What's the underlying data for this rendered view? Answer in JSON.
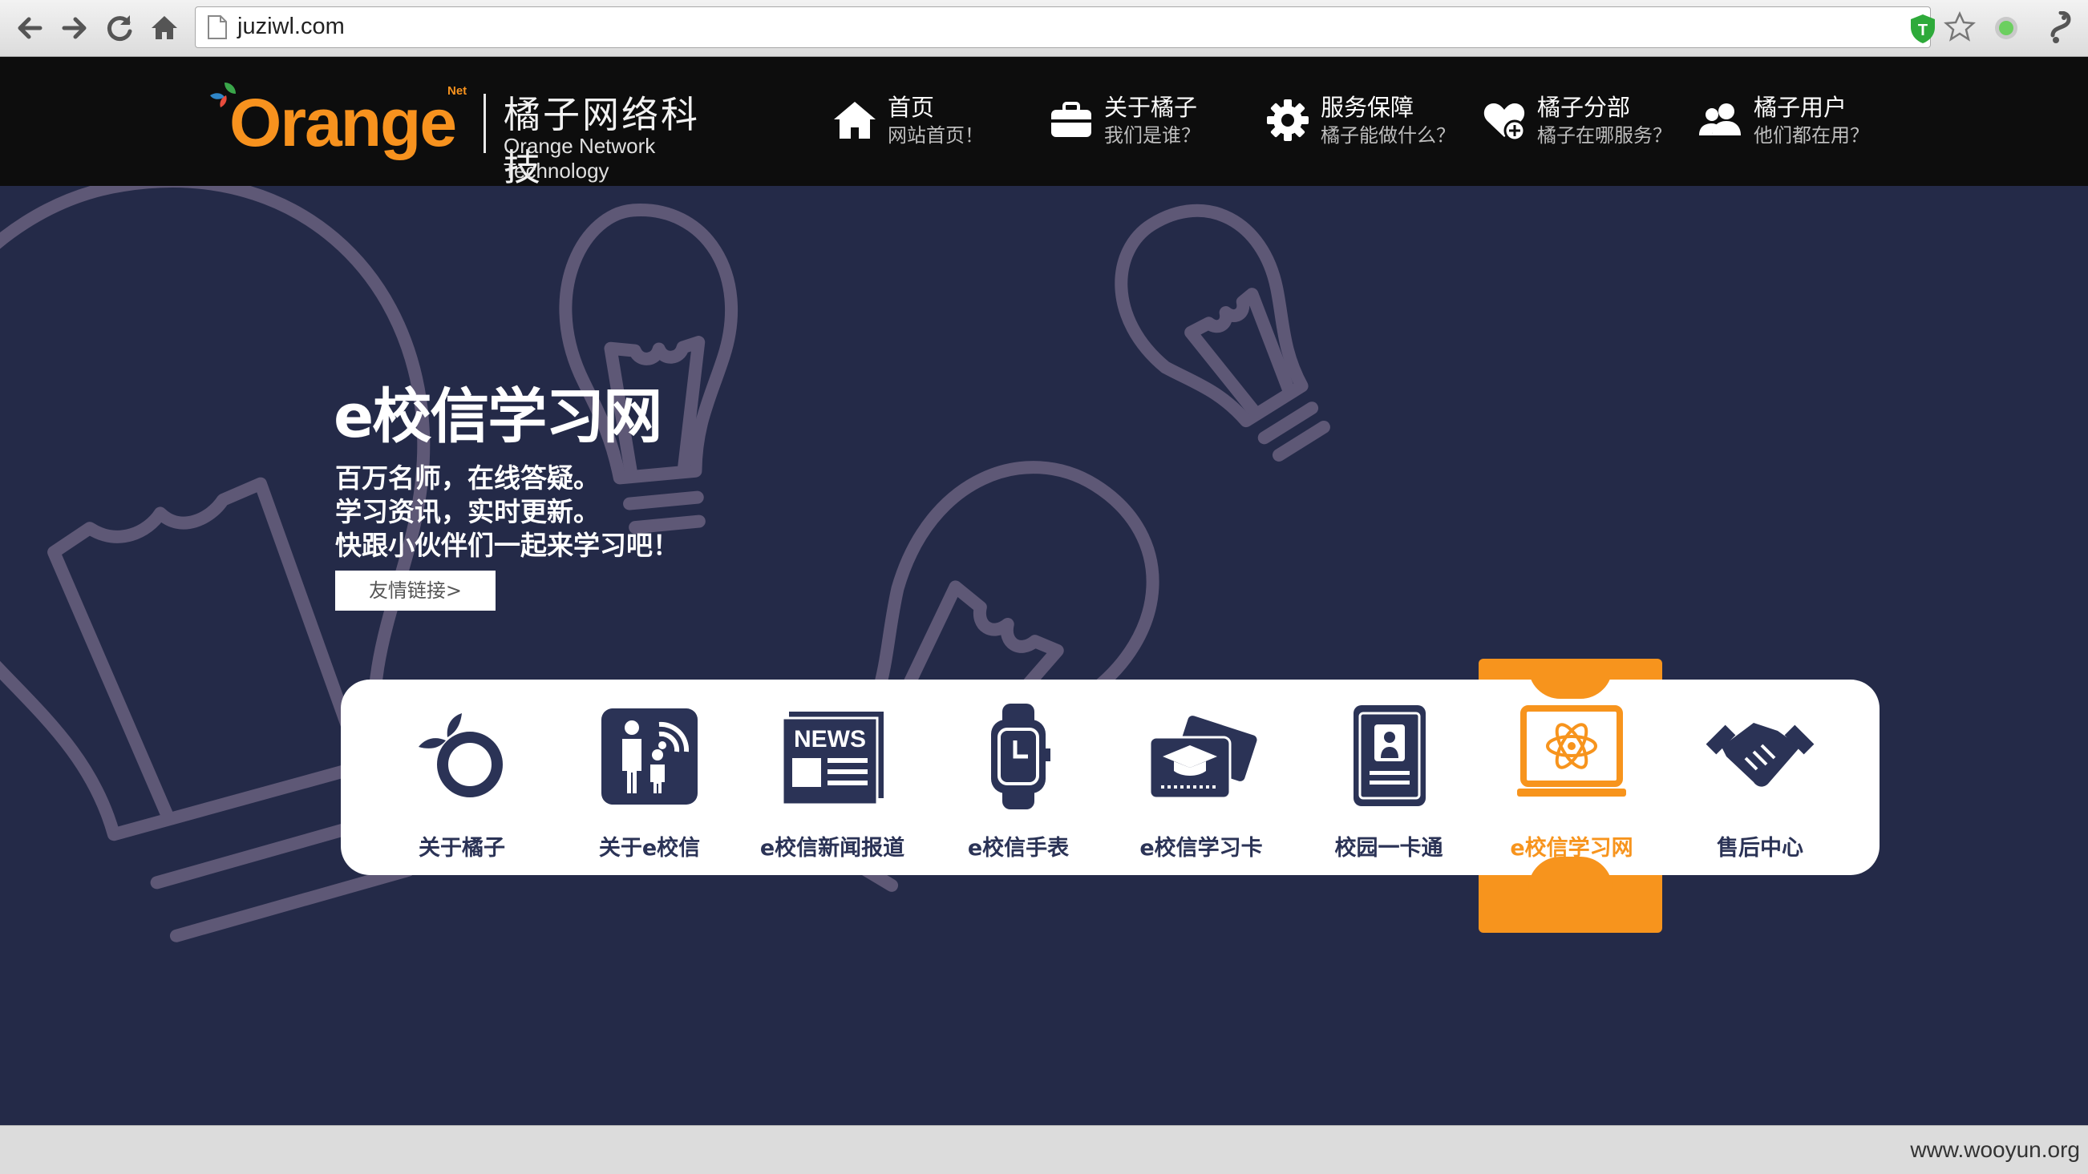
{
  "browser": {
    "url": "juziwl.com",
    "back_icon": "back-arrow-icon",
    "forward_icon": "forward-arrow-icon",
    "reload_icon": "reload-icon",
    "home_icon": "home-icon"
  },
  "header": {
    "logo_word": "Orange",
    "logo_net": "Net",
    "logo_cn": "橘子网络科技",
    "logo_en": "Orange Network Technology",
    "menu": [
      {
        "title": "首页",
        "subtitle": "网站首页！",
        "icon": "home-icon"
      },
      {
        "title": "关于橘子",
        "subtitle": "我们是谁？",
        "icon": "briefcase-icon"
      },
      {
        "title": "服务保障",
        "subtitle": "橘子能做什么？",
        "icon": "gear-icon"
      },
      {
        "title": "橘子分部",
        "subtitle": "橘子在哪服务？",
        "icon": "heart-plus-icon"
      },
      {
        "title": "橘子用户",
        "subtitle": "他们都在用？",
        "icon": "users-icon"
      }
    ]
  },
  "hero": {
    "title": "e校信学习网",
    "lines": [
      "百万名师，在线答疑。",
      "学习资讯，实时更新。",
      "快跟小伙伴们一起来学习吧！"
    ],
    "button": "友情链接>"
  },
  "products": [
    {
      "label": "关于橘子",
      "icon": "orange-icon"
    },
    {
      "label": "关于e校信",
      "icon": "parent-child-icon"
    },
    {
      "label": "e校信新闻报道",
      "icon": "news-icon",
      "icon_text": "NEWS"
    },
    {
      "label": "e校信手表",
      "icon": "watch-icon"
    },
    {
      "label": "e校信学习卡",
      "icon": "study-card-icon"
    },
    {
      "label": "校园一卡通",
      "icon": "campus-card-icon"
    },
    {
      "label": "e校信学习网",
      "icon": "learning-network-icon",
      "active": true
    },
    {
      "label": "售后中心",
      "icon": "handshake-icon"
    }
  ],
  "colors": {
    "accent": "#f7941d",
    "hero_bg": "#242a48",
    "header_bg": "#0d0d0d",
    "product_text": "#2b3356"
  },
  "statusbar": {
    "watermark": "www.wooyun.org"
  }
}
